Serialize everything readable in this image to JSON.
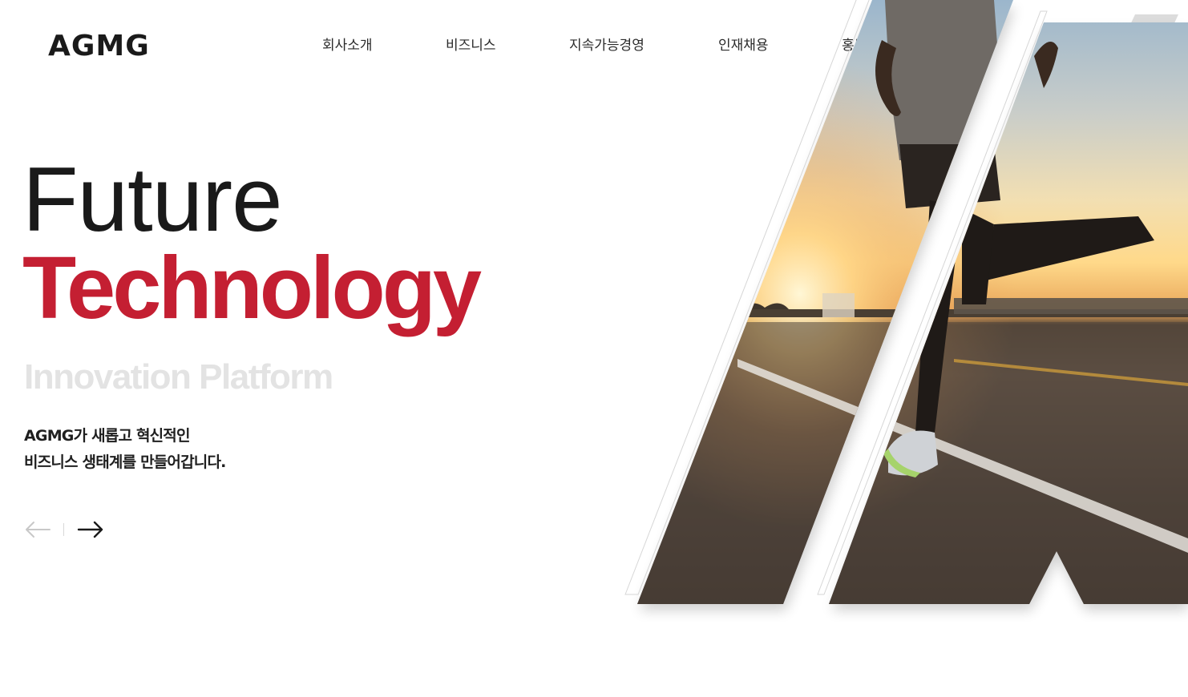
{
  "header": {
    "logo_text": "AGMG",
    "nav": [
      {
        "label": "회사소개"
      },
      {
        "label": "비즈니스"
      },
      {
        "label": "지속가능경영"
      },
      {
        "label": "인재채용"
      },
      {
        "label": "홍보센터"
      }
    ]
  },
  "hero": {
    "line1": "Future",
    "line2": "Technology",
    "line3": "Innovation Platform",
    "description": [
      "AGMG가 새롭고 혁신적인",
      "비즈니스 생태계를 만들어갑니다."
    ]
  },
  "slider": {
    "prev_icon": "arrow-left-icon",
    "next_icon": "arrow-right-icon"
  },
  "colors": {
    "accent": "#c41f32",
    "text": "#1a1a1a",
    "muted": "#e3e3e3"
  }
}
